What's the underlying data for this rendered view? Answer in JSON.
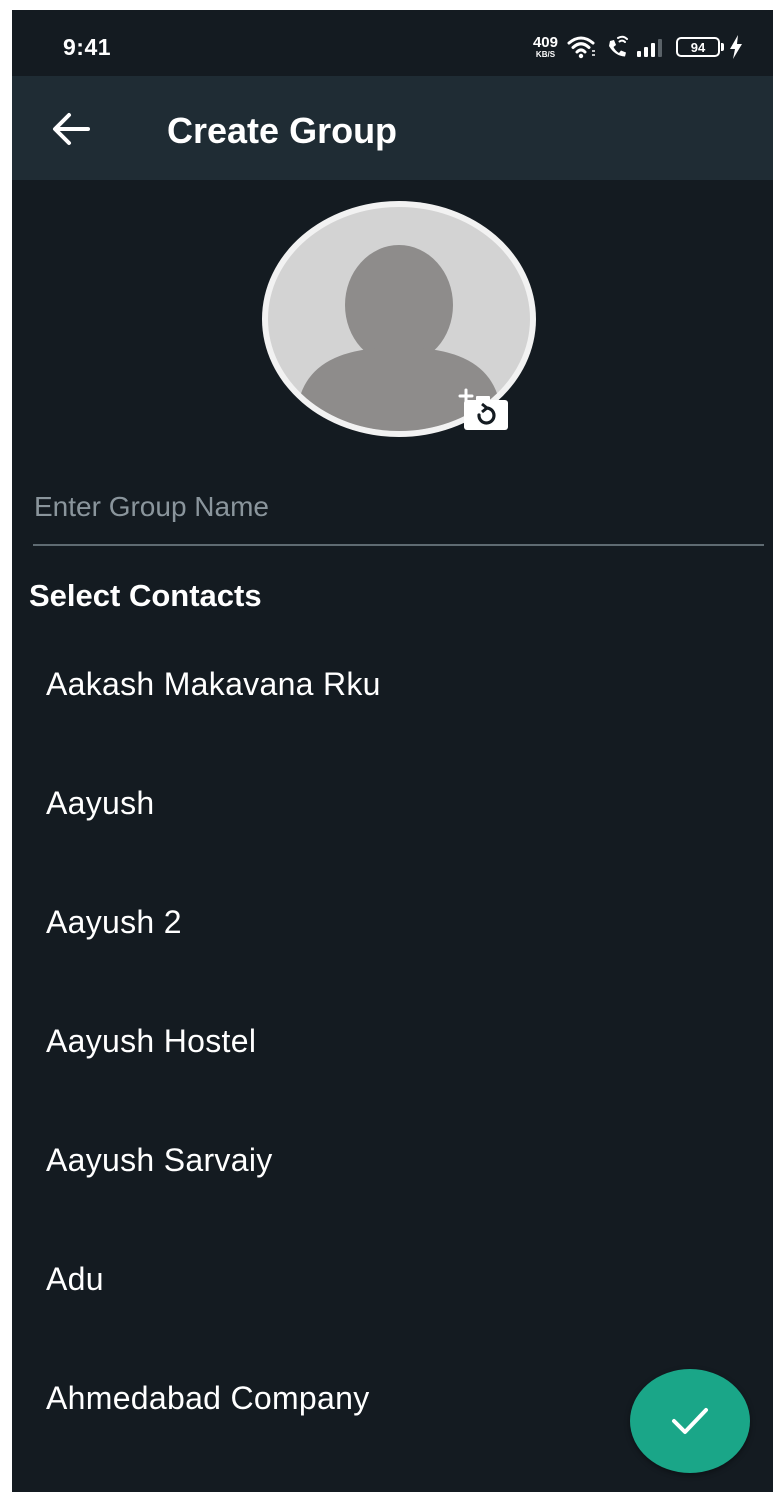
{
  "status_bar": {
    "time": "9:41",
    "net_speed_value": "409",
    "net_speed_unit": "KB/S",
    "battery_level": "94"
  },
  "app_bar": {
    "title": "Create Group",
    "back_icon": "arrow-left-icon"
  },
  "group_photo": {
    "placeholder_icon": "person-silhouette-icon",
    "camera_icon": "add-camera-icon"
  },
  "group_name": {
    "placeholder": "Enter Group Name",
    "value": ""
  },
  "contacts": {
    "title": "Select Contacts",
    "items": [
      {
        "name": "Aakash Makavana Rku"
      },
      {
        "name": "Aayush"
      },
      {
        "name": "Aayush 2"
      },
      {
        "name": "Aayush Hostel"
      },
      {
        "name": "Aayush Sarvaiy"
      },
      {
        "name": "Adu"
      },
      {
        "name": "Ahmedabad Company"
      }
    ]
  },
  "fab": {
    "icon": "check-icon"
  },
  "colors": {
    "background": "#141b21",
    "app_bar": "#1f2c34",
    "accent": "#1aa688",
    "divider": "#5f6b72",
    "placeholder_text": "#8a959c"
  }
}
